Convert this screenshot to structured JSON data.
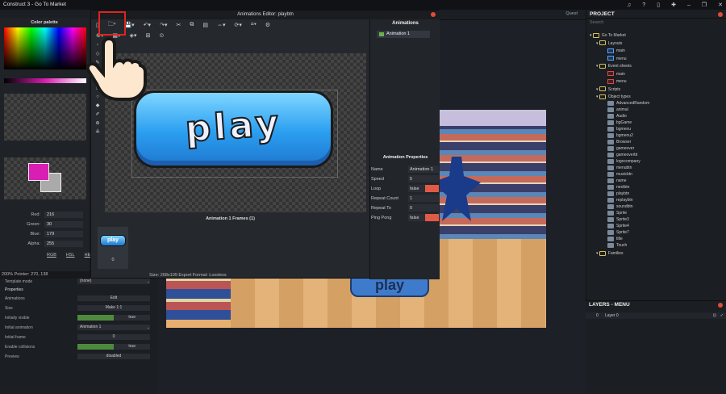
{
  "app": {
    "title": "Construct 3 - Go To Market",
    "quest": "Quest",
    "status_left": "200%   Pointer: 270, 138"
  },
  "palette": {
    "title": "Color palette",
    "channels": [
      {
        "label": "Red:",
        "value": "216"
      },
      {
        "label": "Green:",
        "value": "30"
      },
      {
        "label": "Blue:",
        "value": "179"
      },
      {
        "label": "Alpha:",
        "value": "255"
      }
    ],
    "modes": [
      "RGB",
      "HSL",
      "HEX"
    ],
    "fg": "#d81eb3"
  },
  "editor": {
    "title": "Animations Editor: playbtn",
    "frames_title": "Animation 1 Frames (1)",
    "frame_number": "0",
    "status": "Size: 268x109   Export Format: Lossless",
    "sprite_text": "play",
    "mini_text": "play"
  },
  "animations": {
    "header": "Animations",
    "items": [
      "Animation 1"
    ]
  },
  "anim_props": {
    "header": "Animation Properties",
    "rows": [
      {
        "k": "Name",
        "v": "Animation 1"
      },
      {
        "k": "Speed",
        "v": "5"
      },
      {
        "k": "Loop",
        "v": "false",
        "bool": true
      },
      {
        "k": "Repeat Count",
        "v": "1"
      },
      {
        "k": "Repeat To",
        "v": "0"
      },
      {
        "k": "Ping Pong",
        "v": "false",
        "bool": true
      }
    ]
  },
  "props": {
    "template_mode": "Template mode",
    "template_value": "(none)",
    "section": "Properties",
    "rows": [
      {
        "k": "Animations",
        "v": "Edit"
      },
      {
        "k": "Size",
        "v": "Make 1:1"
      },
      {
        "k": "Initially visible",
        "v": "true",
        "g": true
      },
      {
        "k": "Initial animation",
        "v": "Animation 1",
        "sel": true
      },
      {
        "k": "Initial frame",
        "v": "0"
      },
      {
        "k": "Enable collisions",
        "v": "true",
        "g": true
      },
      {
        "k": "Preview",
        "v": "disabled"
      }
    ]
  },
  "project": {
    "header": "PROJECT",
    "search": "Search",
    "root": "Go To Market",
    "layouts_label": "Layouts",
    "layouts": [
      "main",
      "menu"
    ],
    "sheets_label": "Event sheets",
    "sheets": [
      "main",
      "menu"
    ],
    "scripts_label": "Scripts",
    "objtypes_label": "Object types",
    "objects": [
      "AdvancedRandom",
      "animal",
      "Audio",
      "bgGame",
      "bgmenu",
      "bgmenu2",
      "Browser",
      "gameover",
      "gameoverbt",
      "logocompany",
      "menubtn",
      "musicbtn",
      "name",
      "nextbtn",
      "playbtn",
      "replaybtn",
      "soundbtn",
      "Sprite",
      "Sprite3",
      "Sprite4",
      "Sprite7",
      "title",
      "Touch"
    ],
    "families_label": "Families"
  },
  "layers": {
    "header": "LAYERS - MENU",
    "row_index": "0",
    "row_name": "Layer 0"
  },
  "icons": [
    "folder-icon",
    "save-icon",
    "undo-icon",
    "redo-icon",
    "cut-icon",
    "copy-icon",
    "paste-icon",
    "crop-icon",
    "settings-icon",
    "add-icon",
    "pointer-hand-icon",
    "close-icon"
  ]
}
